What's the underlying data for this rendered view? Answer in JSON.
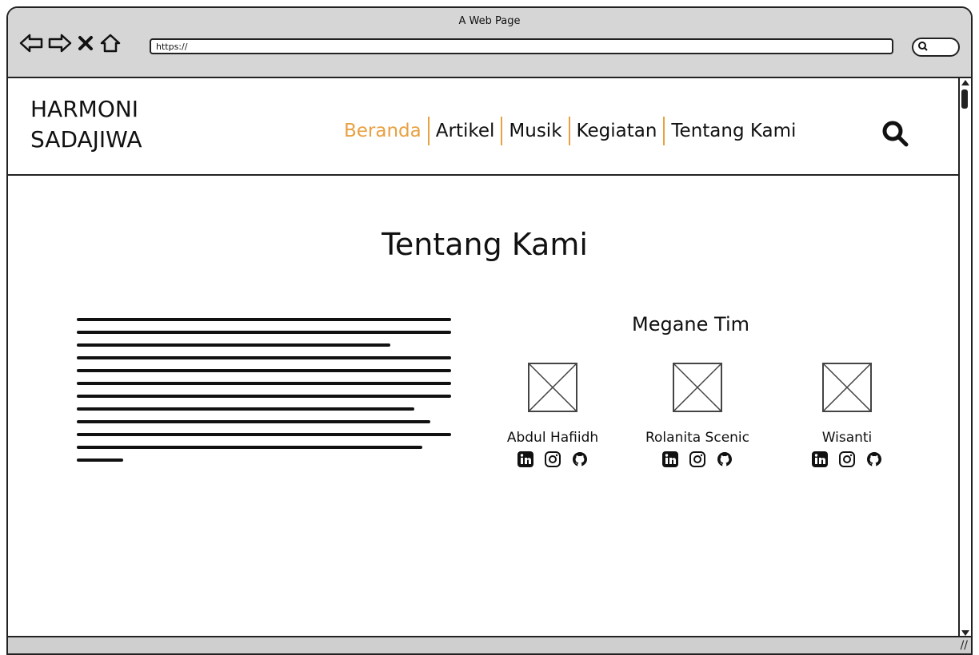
{
  "window": {
    "title": "A Web Page"
  },
  "address_bar": {
    "url": "https://"
  },
  "site": {
    "brand": "HARMONI\nSADAJIWA",
    "nav": [
      {
        "label": "Beranda",
        "active": true
      },
      {
        "label": "Artikel",
        "active": false
      },
      {
        "label": "Musik",
        "active": false
      },
      {
        "label": "Kegiatan",
        "active": false
      },
      {
        "label": "Tentang Kami",
        "active": false
      }
    ],
    "accent_color": "#e8a040"
  },
  "page": {
    "title": "Tentang Kami",
    "team_title": "Megane Tim",
    "members": [
      {
        "name": "Abdul Hafiidh",
        "socials": [
          "linkedin-icon",
          "instagram-icon",
          "github-icon"
        ]
      },
      {
        "name": "Rolanita Scenic",
        "socials": [
          "linkedin-icon",
          "instagram-icon",
          "github-icon"
        ]
      },
      {
        "name": "Wisanti",
        "socials": [
          "linkedin-icon",
          "instagram-icon",
          "github-icon"
        ]
      }
    ]
  }
}
